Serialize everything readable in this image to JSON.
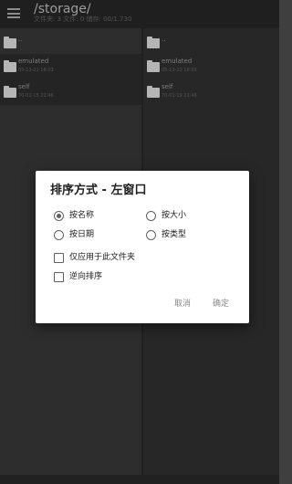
{
  "appbar": {
    "path": "/storage/",
    "subtitle": "文件夹: 3 文件: 0 储存: 00/1.730"
  },
  "left_pane": {
    "items": [
      {
        "name": "..",
        "date": ""
      },
      {
        "name": "emulated",
        "date": "05-13-22 18:03"
      },
      {
        "name": "self",
        "date": "70-01-15 22:46"
      }
    ]
  },
  "right_pane": {
    "items": [
      {
        "name": "..",
        "date": ""
      },
      {
        "name": "emulated",
        "date": "05-13-22 18:03"
      },
      {
        "name": "self",
        "date": "70-01-19 22:46"
      }
    ]
  },
  "dialog": {
    "title": "排序方式 - 左窗口",
    "sort_options": [
      {
        "label": "按名称",
        "selected": true
      },
      {
        "label": "按大小",
        "selected": false
      },
      {
        "label": "按日期",
        "selected": false
      },
      {
        "label": "按类型",
        "selected": false
      }
    ],
    "checkboxes": [
      {
        "label": "仅应用于此文件夹",
        "checked": false
      },
      {
        "label": "逆向排序",
        "checked": false
      }
    ],
    "cancel_label": "取消",
    "ok_label": "确定"
  }
}
